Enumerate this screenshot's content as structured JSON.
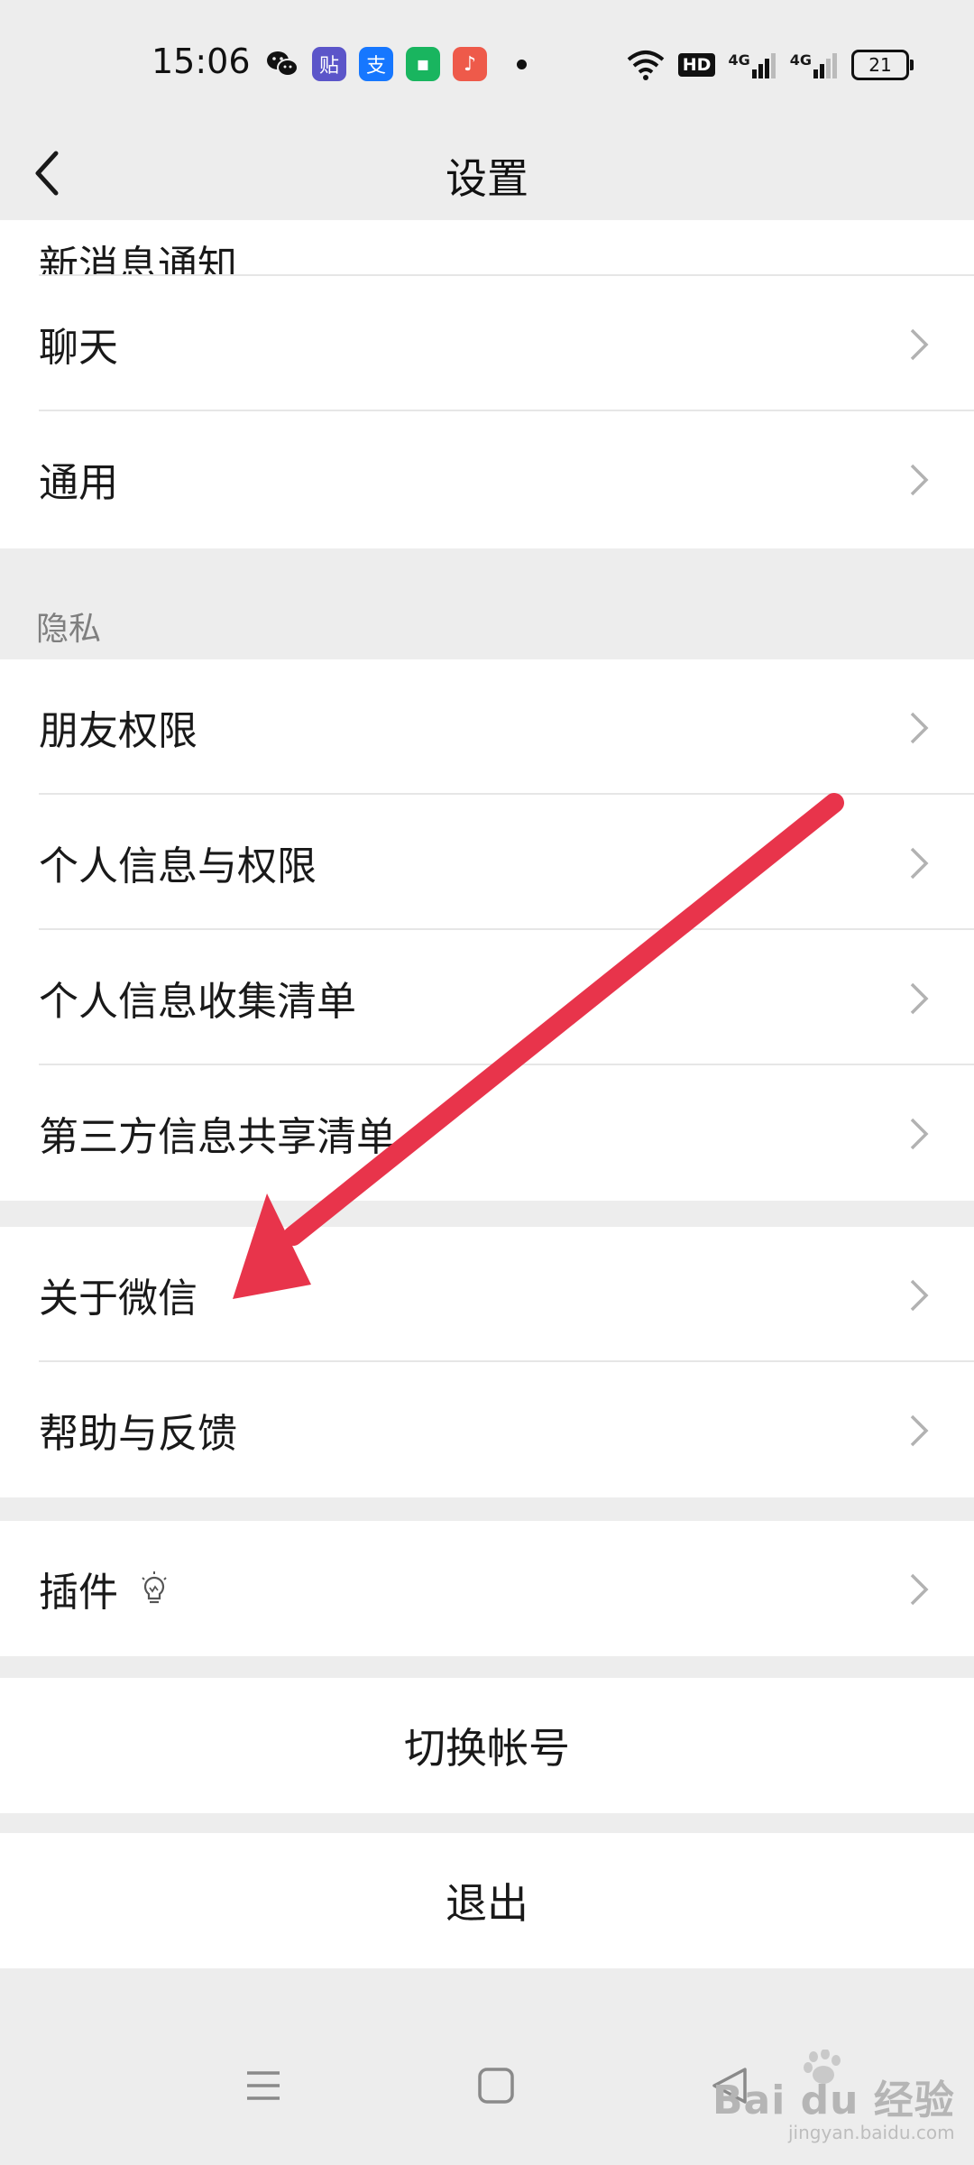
{
  "status_bar": {
    "time": "15:06",
    "network_badge": "HD",
    "signal_1": "4G",
    "signal_2": "4G",
    "battery": "21",
    "notifications": [
      {
        "name": "wechat-icon",
        "glyph": "",
        "color": "#ededed"
      },
      {
        "name": "tieba-icon",
        "glyph": "贴",
        "color": "#5b55c9"
      },
      {
        "name": "alipay-icon",
        "glyph": "支",
        "color": "#1677ff"
      },
      {
        "name": "chat-app-icon",
        "glyph": "▪",
        "color": "#19b55f"
      },
      {
        "name": "music-app-icon",
        "glyph": "♪",
        "color": "#ee5a4a"
      }
    ]
  },
  "nav": {
    "title": "设置"
  },
  "list": {
    "partial_item": "新消息通知",
    "group1": [
      "聊天",
      "通用"
    ],
    "privacy_label": "隐私",
    "privacy_items": [
      "朋友权限",
      "个人信息与权限",
      "个人信息收集清单",
      "第三方信息共享清单"
    ],
    "group3": [
      "关于微信",
      "帮助与反馈"
    ],
    "plugins": "插件",
    "switch_account": "切换帐号",
    "logout": "退出"
  },
  "watermark": {
    "brand": "Bai du 经验",
    "url": "jingyan.baidu.com"
  },
  "colors": {
    "background": "#ededed",
    "arrow": "#e8344b"
  }
}
